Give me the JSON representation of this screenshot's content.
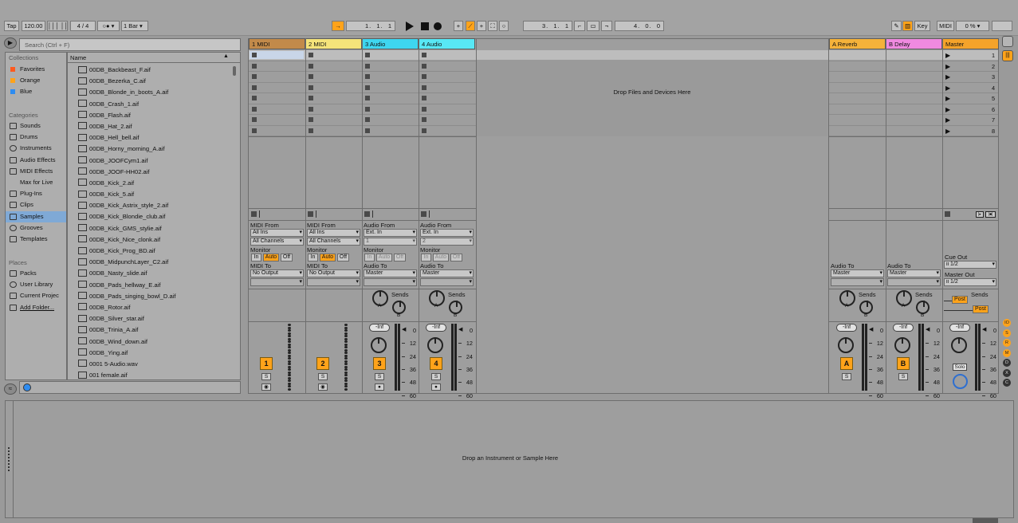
{
  "transport": {
    "tap": "Tap",
    "tempo": "120.00",
    "time_sig_num": "4",
    "time_sig_sep": "/",
    "time_sig_den": "4",
    "quantize": "1 Bar",
    "position": [
      "1.",
      "1.",
      "1"
    ],
    "loop_start": [
      "3.",
      "1.",
      "1"
    ],
    "loop_length": [
      "4.",
      "0.",
      "0"
    ],
    "key_label": "Key",
    "midi_label": "MIDI",
    "cpu": "0 %"
  },
  "browser": {
    "search_placeholder": "Search (Ctrl + F)",
    "collections_header": "Collections",
    "collections": [
      {
        "label": "Favorites",
        "color": "#ff5a1f"
      },
      {
        "label": "Orange",
        "color": "#ffa31a"
      },
      {
        "label": "Blue",
        "color": "#2e8cf0"
      }
    ],
    "categories_header": "Categories",
    "categories": [
      "Sounds",
      "Drums",
      "Instruments",
      "Audio Effects",
      "MIDI Effects",
      "Max for Live",
      "Plug-Ins",
      "Clips",
      "Samples",
      "Grooves",
      "Templates"
    ],
    "selected_category": "Samples",
    "places_header": "Places",
    "places": [
      "Packs",
      "User Library",
      "Current Projec",
      "Add Folder..."
    ],
    "name_header": "Name",
    "files": [
      "00DB_Backbeast_F.aif",
      "00DB_Bezerka_C.aif",
      "00DB_Blonde_in_boots_A.aif",
      "00DB_Crash_1.aif",
      "00DB_Flash.aif",
      "00DB_Hat_2.aif",
      "00DB_Hell_bell.aif",
      "00DB_Horny_morning_A.aif",
      "00DB_JOOFCym1.aif",
      "00DB_JOOF-HH02.aif",
      "00DB_Kick_2.aif",
      "00DB_Kick_5.aif",
      "00DB_Kick_Astrix_style_2.aif",
      "00DB_Kick_Blondie_club.aif",
      "00DB_Kick_GMS_stylie.aif",
      "00DB_Kick_Nice_clonk.aif",
      "00DB_Kick_Prog_BD.aif",
      "00DB_MidpunchLayer_C2.aif",
      "00DB_Nasty_slide.aif",
      "00DB_Pads_hellway_E.aif",
      "00DB_Pads_singing_bowl_D.aif",
      "00DB_Rotor.aif",
      "00DB_Silver_star.aif",
      "00DB_Trinia_A.aif",
      "00DB_Wind_down.aif",
      "00DB_Ying.aif",
      "0001 5-Audio.wav",
      "001 female.aif"
    ]
  },
  "tracks": [
    {
      "name": "1 MIDI",
      "color": "#c28a4a",
      "num": "1",
      "from_label": "MIDI From",
      "from": "All Ins",
      "channel": "All Channels",
      "monitor_label": "Monitor",
      "to_label": "MIDI To",
      "to": "No Output"
    },
    {
      "name": "2 MIDI",
      "color": "#f5e47a",
      "num": "2",
      "from_label": "MIDI From",
      "from": "All Ins",
      "channel": "All Channels",
      "monitor_label": "Monitor",
      "to_label": "MIDI To",
      "to": "No Output"
    },
    {
      "name": "3 Audio",
      "color": "#3ed6f0",
      "num": "3",
      "from_label": "Audio From",
      "from": "Ext. In",
      "channel": "1",
      "monitor_label": "Monitor",
      "to_label": "Audio To",
      "to": "Master"
    },
    {
      "name": "4 Audio",
      "color": "#58e8f5",
      "num": "4",
      "from_label": "Audio From",
      "from": "Ext. In",
      "channel": "2",
      "monitor_label": "Monitor",
      "to_label": "Audio To",
      "to": "Master"
    }
  ],
  "returns": [
    {
      "name": "A Reverb",
      "color": "#f5b23a",
      "num": "A",
      "to_label": "Audio To",
      "to": "Master"
    },
    {
      "name": "B Delay",
      "color": "#f08ae0",
      "num": "B",
      "to_label": "Audio To",
      "to": "Master"
    }
  ],
  "master": {
    "name": "Master",
    "color": "#f5a32a",
    "cue_label": "Cue Out",
    "cue": "ii 1/2",
    "out_label": "Master Out",
    "out": "ii 1/2",
    "solo": "Solo",
    "post": "Post"
  },
  "monitor_buttons": [
    "In",
    "Auto",
    "Off"
  ],
  "sends_label": "Sends",
  "send_a": "A",
  "send_b": "B",
  "solo_btn": "S",
  "inf_label": "-Inf",
  "scale": [
    "0",
    "12",
    "24",
    "36",
    "48",
    "60"
  ],
  "scenes": [
    "1",
    "2",
    "3",
    "4",
    "5",
    "6",
    "7",
    "8"
  ],
  "drop_files": "Drop Files and Devices Here",
  "drop_instrument": "Drop an Instrument or Sample Here",
  "side_buttons": [
    "IO",
    "S",
    "R",
    "M",
    "D",
    "X",
    "C"
  ]
}
